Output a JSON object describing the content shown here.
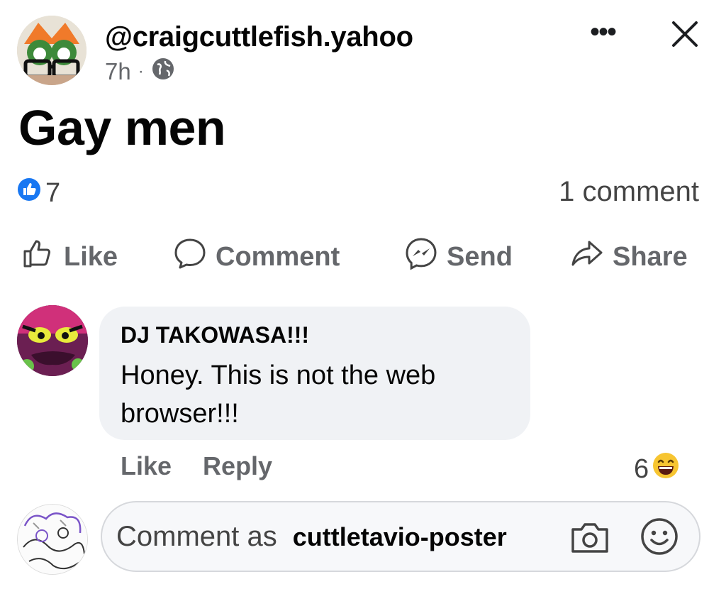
{
  "post": {
    "author": "@craigcuttlefish.yahoo",
    "time": "7h",
    "separator": "·",
    "audience_icon": "globe-icon",
    "text": "Gay men",
    "reaction_count": "7",
    "comment_count": "1 comment"
  },
  "header_icons": [
    "more-icon",
    "close-icon"
  ],
  "actions": {
    "like": "Like",
    "comment": "Comment",
    "send": "Send",
    "share": "Share"
  },
  "comment": {
    "author": "DJ TAKOWASA!!!",
    "text": "Honey. This is not the web browser!!!",
    "like": "Like",
    "reply": "Reply",
    "reaction_count": "6"
  },
  "composer": {
    "placeholder": "Comment as",
    "username": "cuttletavio-poster"
  },
  "colors": {
    "accent_blue": "#1877f2",
    "muted_text": "#65676b",
    "bubble_bg": "#f0f2f5"
  }
}
